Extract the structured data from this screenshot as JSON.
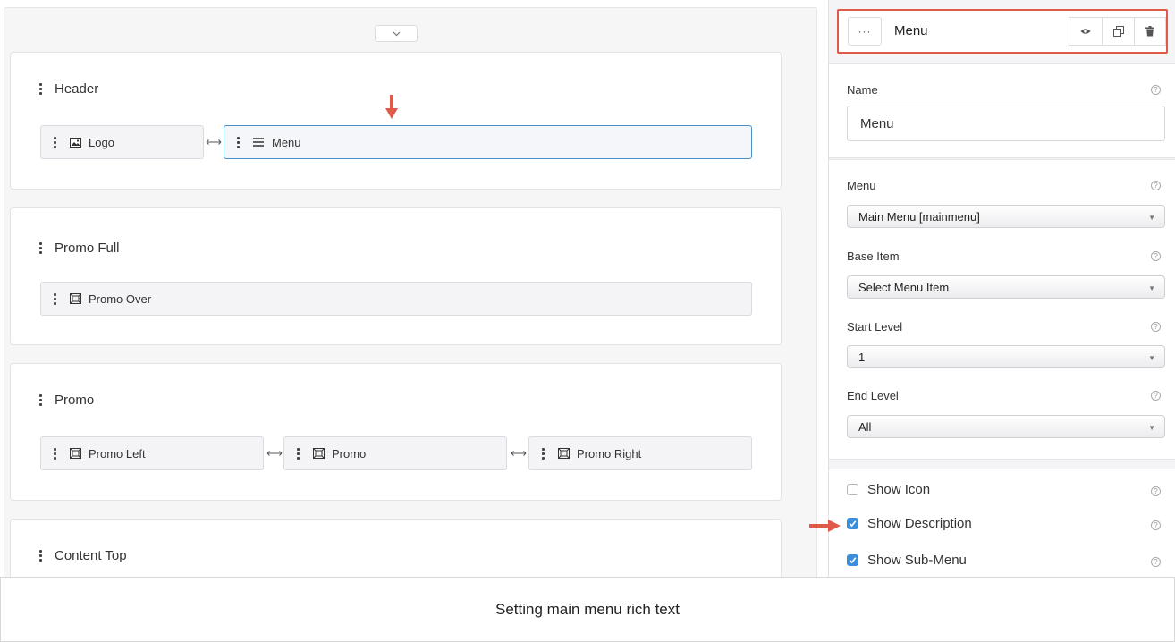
{
  "layout_sections": [
    {
      "title": "Header",
      "particles": [
        {
          "label": "Logo",
          "icon": "image-icon"
        },
        {
          "label": "Menu",
          "icon": "hamburger-icon",
          "selected": true
        }
      ]
    },
    {
      "title": "Promo Full",
      "particles": [
        {
          "label": "Promo Over",
          "icon": "position-icon"
        }
      ]
    },
    {
      "title": "Promo",
      "particles": [
        {
          "label": "Promo Left",
          "icon": "position-icon"
        },
        {
          "label": "Promo",
          "icon": "position-icon"
        },
        {
          "label": "Promo Right",
          "icon": "position-icon"
        }
      ]
    },
    {
      "title": "Content Top",
      "particles": []
    }
  ],
  "collapse_icon": "chevron-down-icon",
  "panel": {
    "more_label": "···",
    "title": "Menu",
    "actions": [
      "eye-icon",
      "duplicate-icon",
      "trash-icon"
    ],
    "name_label": "Name",
    "name_value": "Menu",
    "menu_label": "Menu",
    "menu_value": "Main Menu [mainmenu]",
    "base_item_label": "Base Item",
    "base_item_value": "Select Menu Item",
    "start_level_label": "Start Level",
    "start_level_value": "1",
    "end_level_label": "End Level",
    "end_level_value": "All",
    "checkboxes": [
      {
        "label": "Show Icon",
        "checked": false
      },
      {
        "label": "Show Description",
        "checked": true
      },
      {
        "label": "Show Sub-Menu",
        "checked": true
      }
    ],
    "help_glyph": "?"
  },
  "annotation_color": "#e05a4a",
  "accent_color": "#3a8fdc",
  "caption": "Setting main menu rich text"
}
